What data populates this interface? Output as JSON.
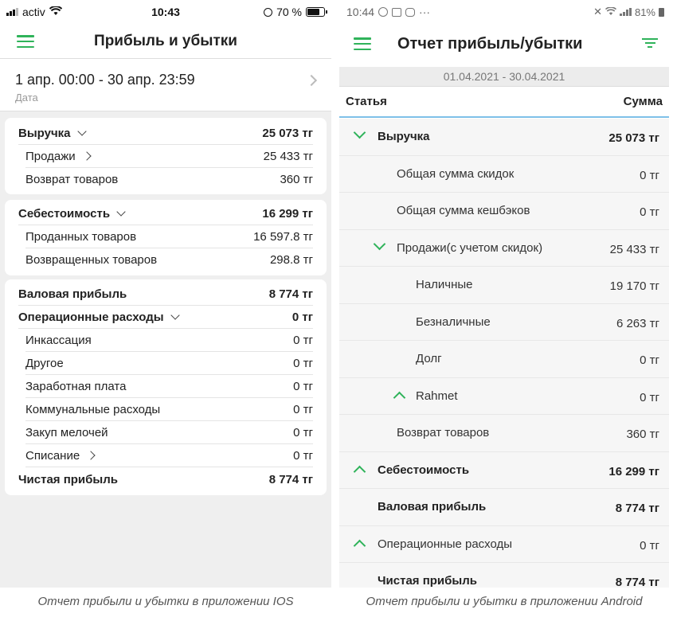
{
  "ios": {
    "status": {
      "carrier": "activ",
      "time": "10:43",
      "battery": "70 %"
    },
    "title": "Прибыль и убытки",
    "date_range": "1 апр. 00:00 - 30 апр. 23:59",
    "date_label": "Дата",
    "revenue": {
      "label": "Выручка",
      "value": "25 073 тг",
      "items": [
        {
          "label": "Продажи",
          "value": "25 433 тг"
        },
        {
          "label": "Возврат товаров",
          "value": "360 тг"
        }
      ]
    },
    "cost": {
      "label": "Себестоимость",
      "value": "16 299 тг",
      "items": [
        {
          "label": "Проданных товаров",
          "value": "16 597.8 тг"
        },
        {
          "label": "Возвращенных товаров",
          "value": "298.8 тг"
        }
      ]
    },
    "gross": {
      "label": "Валовая прибыль",
      "value": "8 774 тг"
    },
    "opex": {
      "label": "Операционные расходы",
      "value": "0 тг",
      "items": [
        {
          "label": "Инкассация",
          "value": "0 тг"
        },
        {
          "label": "Другое",
          "value": "0 тг"
        },
        {
          "label": "Заработная плата",
          "value": "0 тг"
        },
        {
          "label": "Коммунальные расходы",
          "value": "0 тг"
        },
        {
          "label": "Закуп мелочей",
          "value": "0 тг"
        },
        {
          "label": "Списание",
          "value": "0 тг"
        }
      ]
    },
    "net": {
      "label": "Чистая прибыль",
      "value": "8 774 тг"
    },
    "caption": "Отчет прибыли и убытки в приложении IOS"
  },
  "android": {
    "status": {
      "time": "10:44",
      "dots": "···",
      "battery": "81%"
    },
    "title": "Отчет прибыль/убытки",
    "period": "01.04.2021 - 30.04.2021",
    "col_item": "Статья",
    "col_sum": "Сумма",
    "rows": [
      {
        "label": "Выручка",
        "value": "25 073 тг"
      },
      {
        "label": "Общая сумма скидок",
        "value": "0 тг"
      },
      {
        "label": "Общая сумма кешбэков",
        "value": "0 тг"
      },
      {
        "label": "Продажи(с учетом скидок)",
        "value": "25 433 тг"
      },
      {
        "label": "Наличные",
        "value": "19 170 тг"
      },
      {
        "label": "Безналичные",
        "value": "6 263 тг"
      },
      {
        "label": "Долг",
        "value": "0 тг"
      },
      {
        "label": "Rahmet",
        "value": "0 тг"
      },
      {
        "label": "Возврат товаров",
        "value": "360 тг"
      },
      {
        "label": "Себестоимость",
        "value": "16 299 тг"
      },
      {
        "label": "Валовая прибыль",
        "value": "8 774 тг"
      },
      {
        "label": "Операционные расходы",
        "value": "0 тг"
      },
      {
        "label": "Чистая прибыль",
        "value": "8 774 тг"
      }
    ],
    "caption": "Отчет прибыли и убытки в приложении Android"
  },
  "colors": {
    "accent": "#2fb35a",
    "header_line": "#7fc0e8"
  }
}
